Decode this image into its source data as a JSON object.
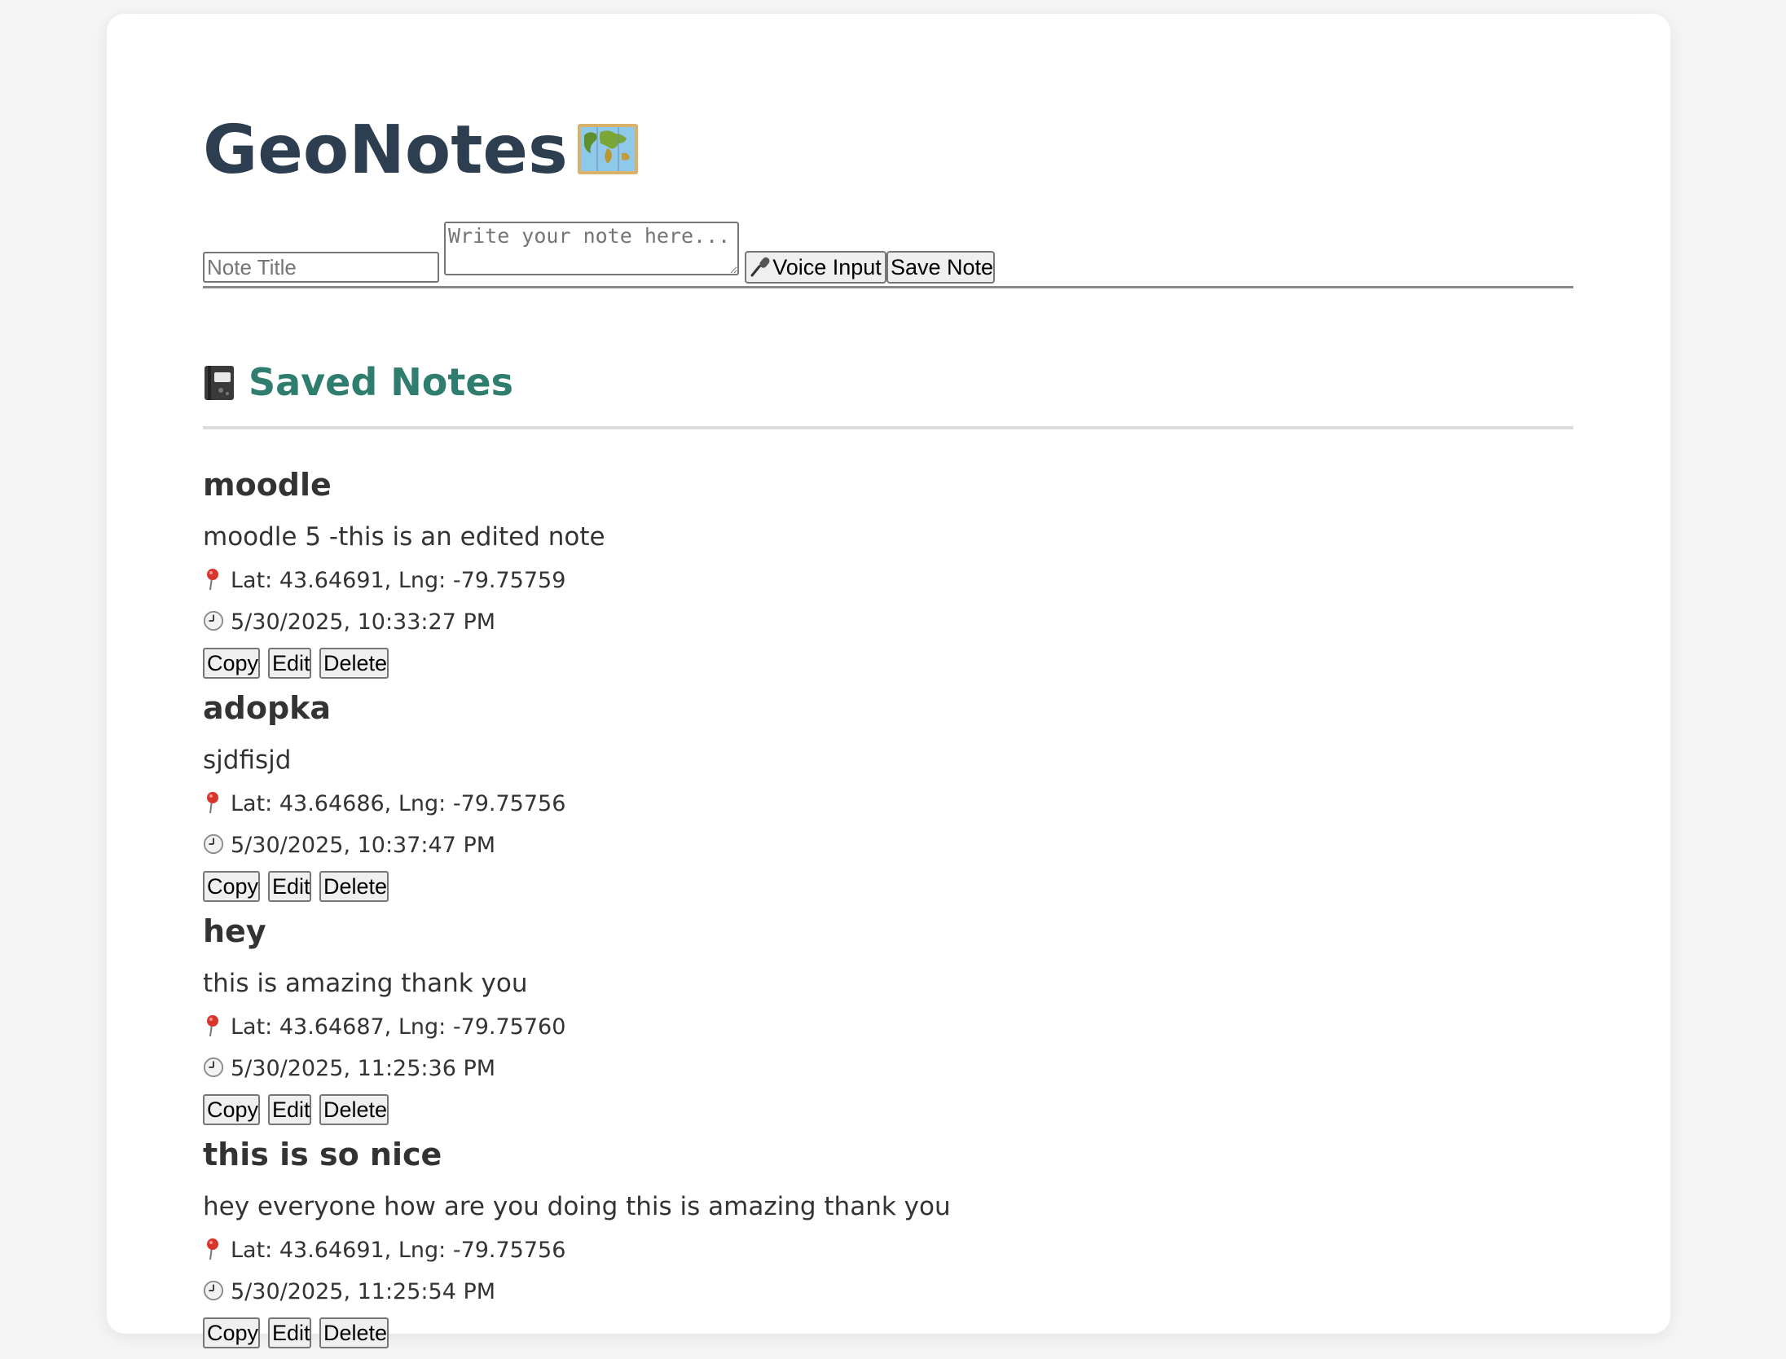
{
  "app": {
    "title": "GeoNotes"
  },
  "form": {
    "title_placeholder": "Note Title",
    "title_value": "",
    "note_placeholder": "Write your note here...",
    "note_value": "",
    "voice_button_label": "Voice Input",
    "save_button_label": "Save Note"
  },
  "saved": {
    "heading": "Saved Notes"
  },
  "notes": [
    {
      "title": "moodle",
      "content": "moodle 5 -this is an edited note",
      "location": "Lat: 43.64691, Lng: -79.75759",
      "timestamp": "5/30/2025, 10:33:27 PM",
      "copy_label": "Copy",
      "edit_label": "Edit",
      "delete_label": "Delete"
    },
    {
      "title": "adopka",
      "content": "sjdfisjd",
      "location": "Lat: 43.64686, Lng: -79.75756",
      "timestamp": "5/30/2025, 10:37:47 PM",
      "copy_label": "Copy",
      "edit_label": "Edit",
      "delete_label": "Delete"
    },
    {
      "title": "hey",
      "content": "this is amazing thank you",
      "location": "Lat: 43.64687, Lng: -79.75760",
      "timestamp": "5/30/2025, 11:25:36 PM",
      "copy_label": "Copy",
      "edit_label": "Edit",
      "delete_label": "Delete"
    },
    {
      "title": "this is so nice",
      "content": "hey everyone how are you doing this is amazing thank you",
      "location": "Lat: 43.64691, Lng: -79.75756",
      "timestamp": "5/30/2025, 11:25:54 PM",
      "copy_label": "Copy",
      "edit_label": "Edit",
      "delete_label": "Delete"
    }
  ],
  "icons": {
    "title_emoji": "world-map-icon",
    "mic": "microphone-icon",
    "saved_heading_emoji": "notebook-icon",
    "location": "round-pushpin-icon",
    "time": "clock-icon"
  }
}
